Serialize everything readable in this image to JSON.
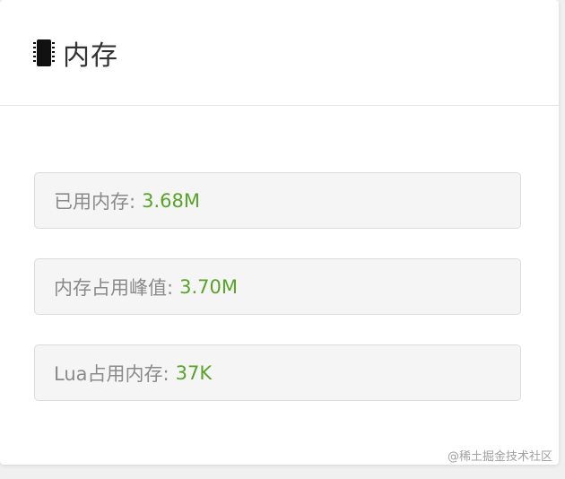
{
  "panel": {
    "title": "内存",
    "icon": "memory-chip-icon"
  },
  "stats": [
    {
      "label": "已用内存:",
      "value": "3.68M"
    },
    {
      "label": "内存占用峰值:",
      "value": "3.70M"
    },
    {
      "label": "Lua占用内存:",
      "value": "37K"
    }
  ],
  "watermark": "@稀土掘金技术社区",
  "colors": {
    "value": "#5aa32a",
    "label": "#8a8a8a",
    "box_background": "#f5f5f5",
    "box_border": "#dcdcdc"
  }
}
